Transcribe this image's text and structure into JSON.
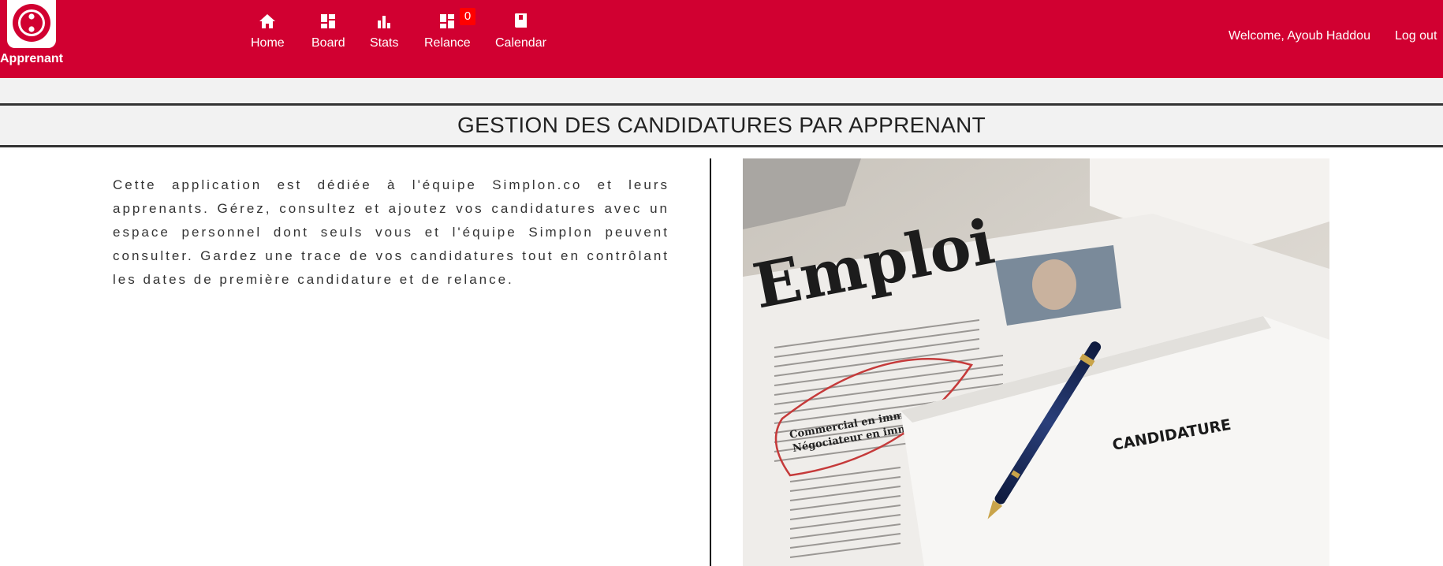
{
  "brand": {
    "label": "Apprenant",
    "icon": "simplon-logo-icon",
    "color": "#d10031"
  },
  "nav": {
    "items": [
      {
        "label": "Home",
        "icon": "home-icon"
      },
      {
        "label": "Board",
        "icon": "dashboard-icon"
      },
      {
        "label": "Stats",
        "icon": "bar-chart-icon"
      },
      {
        "label": "Relance",
        "icon": "dashboard-icon",
        "badge": "0"
      },
      {
        "label": "Calendar",
        "icon": "book-icon"
      }
    ]
  },
  "user": {
    "welcome": "Welcome, Ayoub Haddou",
    "logout": "Log out"
  },
  "page": {
    "title": "GESTION DES CANDIDATURES PAR APPRENANT",
    "description": "Cette application est dédiée à l'équipe Simplon.co et leurs apprenants. Gérez, consultez et ajoutez vos candidatures avec un espace personnel dont seuls vous et l'équipe Simplon peuvent consulter. Gardez une trace de vos candidatures tout en contrôlant les dates de première candidature et de relance."
  },
  "illustration": {
    "newspaper_headline": "Emploi",
    "document_label": "CANDIDATURE",
    "ad_lines": [
      "Commercial en immobilier /",
      "Négociateur en immobilier H/F"
    ]
  }
}
